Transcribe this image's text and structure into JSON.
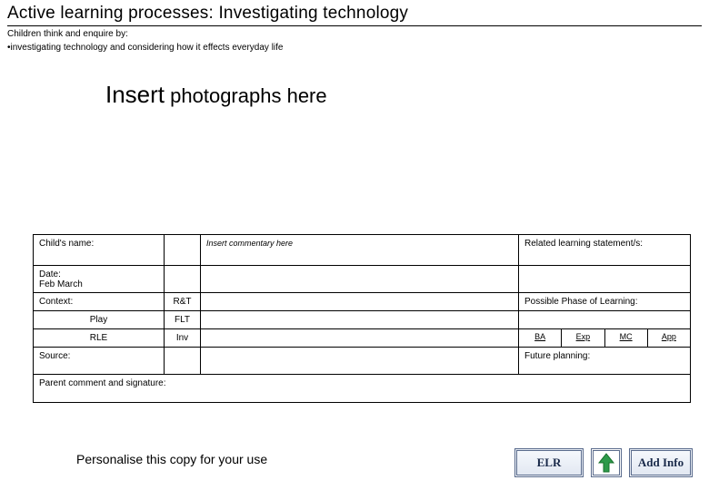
{
  "header": {
    "title": "Active learning processes: Investigating technology",
    "subtitle_line1": "Children think and enquire by:",
    "subtitle_line2": "•investigating technology and considering how it effects everyday life"
  },
  "photo_placeholder": {
    "prefix": "Insert",
    "rest": " photographs here"
  },
  "form": {
    "child_name_label": "Child's name:",
    "commentary_placeholder": "Insert commentary here",
    "related_label": "Related learning statement/s:",
    "date_label": "Date:",
    "date_value": "Feb March",
    "context_label": "Context:",
    "context_tag": "R&T",
    "play_label": "Play",
    "play_tag": "FLT",
    "rle_label": "RLE",
    "rle_tag": "Inv",
    "phase_label": "Possible Phase of Learning:",
    "phases": {
      "ba": "BA",
      "exp": "Exp",
      "mc": "MC",
      "app": "App"
    },
    "source_label": "Source:",
    "future_label": "Future planning:",
    "parent_label": "Parent comment and signature:"
  },
  "footer": {
    "personalise": "Personalise this copy for your use",
    "elr_button": "ELR",
    "add_button": "Add Info"
  }
}
